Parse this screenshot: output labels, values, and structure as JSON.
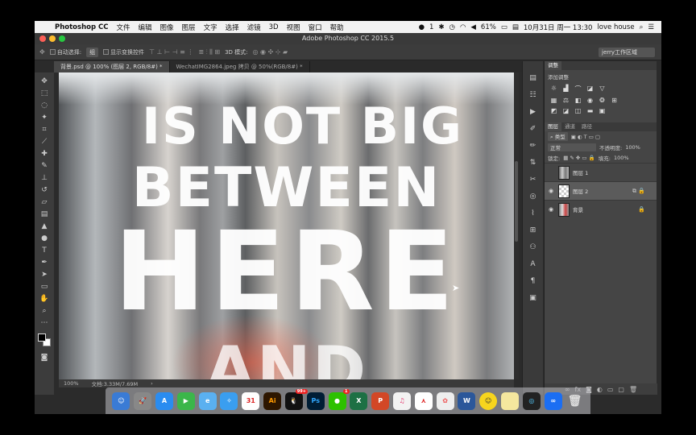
{
  "menubar": {
    "app_name": "Photoshop CC",
    "items": [
      "文件",
      "编辑",
      "图像",
      "图层",
      "文字",
      "选择",
      "滤镜",
      "3D",
      "视图",
      "窗口",
      "帮助"
    ],
    "battery": "61%",
    "datetime": "10月31日 周一 13:30",
    "user": "love house",
    "wechat_count": "1"
  },
  "window": {
    "title": "Adobe Photoshop CC 2015.5"
  },
  "options": {
    "auto_select_label": "自动选择:",
    "auto_select_value": "组",
    "show_transform_label": "显示变换控件",
    "mode_3d_label": "3D 模式:",
    "workspace": "jerry工作区域"
  },
  "tabs": [
    {
      "label": "背景.psd @ 100% (图层 2, RGB/8#) *"
    },
    {
      "label": "WechatIMG2864.jpeg 拷贝 @ 50%(RGB/8#) *"
    }
  ],
  "canvas": {
    "line1": "IS NOT BIG",
    "line2": "BETWEEN",
    "line3": "HERE",
    "line4": "AND"
  },
  "status": {
    "zoom": "100%",
    "doc_size": "文档:3.33M/7.69M"
  },
  "adjust_panel": {
    "tabs": [
      "调整"
    ],
    "label": "添加调整"
  },
  "layers_panel": {
    "tabs": [
      "图层",
      "通道",
      "路径"
    ],
    "filter_label": "类型",
    "blend_mode": "正常",
    "opacity_label": "不透明度:",
    "opacity_value": "100%",
    "lock_label": "锁定:",
    "fill_label": "填充:",
    "fill_value": "100%",
    "layers": [
      {
        "name": "图层 1"
      },
      {
        "name": "图层 2"
      },
      {
        "name": "背景"
      }
    ]
  },
  "dock": {
    "calendar_day": "31",
    "qq_badge": "99+",
    "wechat_badge": "1",
    "ai_label": "Ai",
    "ps_label": "Ps",
    "excel_label": "X",
    "word_label": "W"
  }
}
